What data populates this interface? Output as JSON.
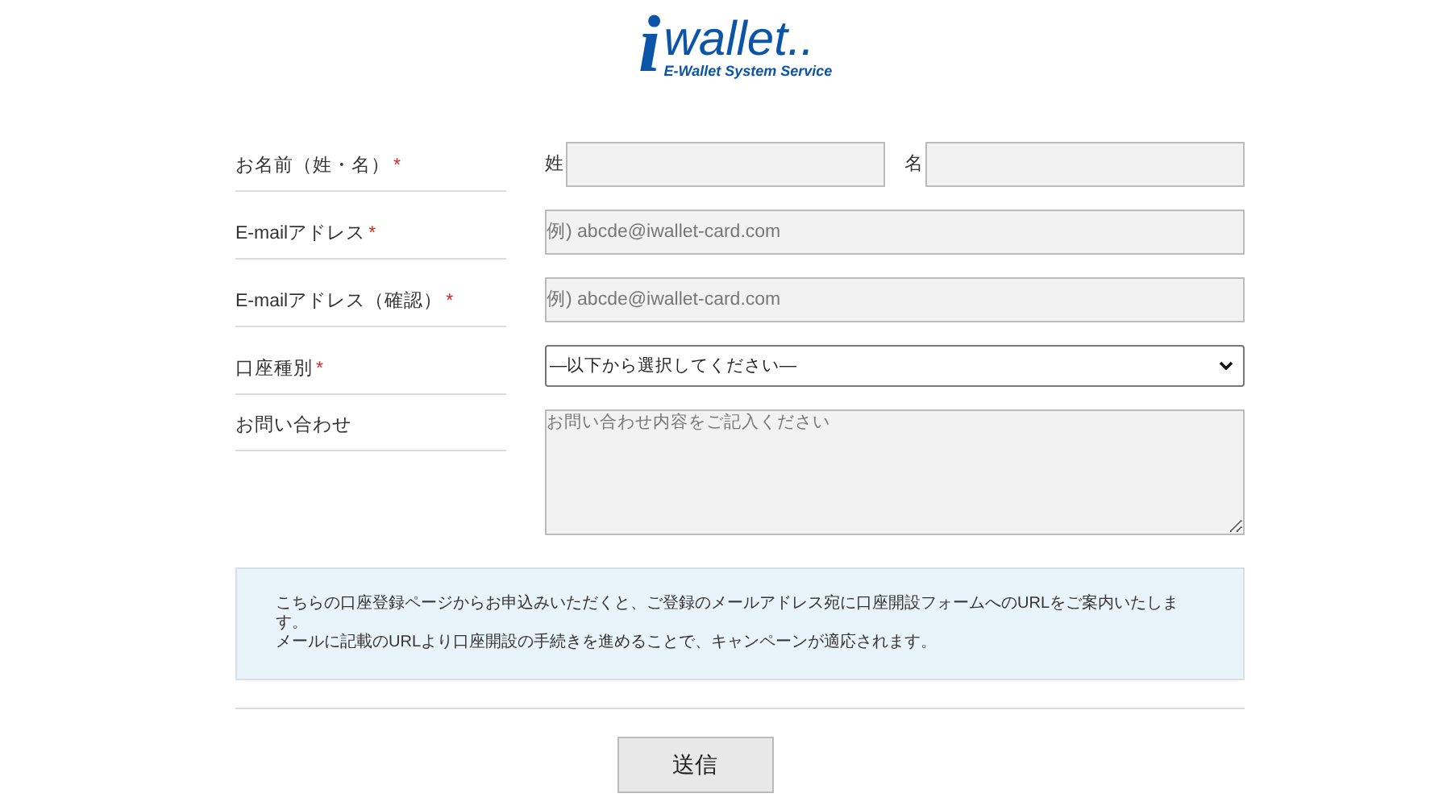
{
  "logo": {
    "mark": "i",
    "name": "wallet..",
    "tagline": "E-Wallet System Service"
  },
  "fields": [
    {
      "kind": "name",
      "label": "お名前（姓・名）",
      "required_mark": "*",
      "parts": [
        {
          "label": "姓"
        },
        {
          "label": "名"
        }
      ]
    },
    {
      "kind": "text",
      "label": "E-mailアドレス",
      "required_mark": "*",
      "placeholder": "例) abcde@iwallet-card.com"
    },
    {
      "kind": "text",
      "label": "E-mailアドレス（確認）",
      "required_mark": "*",
      "placeholder": "例) abcde@iwallet-card.com"
    },
    {
      "kind": "select",
      "label": "口座種別",
      "required_mark": "*",
      "value": "―以下から選択してください―"
    },
    {
      "kind": "textarea",
      "label": "お問い合わせ",
      "placeholder": "お問い合わせ内容をご記入ください"
    }
  ],
  "notice": [
    "こちらの口座登録ページからお申込みいただくと、ご登録のメールアドレス宛に口座開設フォームへのURLをご案内いたします。",
    "メールに記載のURLより口座開設の手続きを進めることで、キャンペーンが適応されます。"
  ],
  "submit_button": "送信"
}
